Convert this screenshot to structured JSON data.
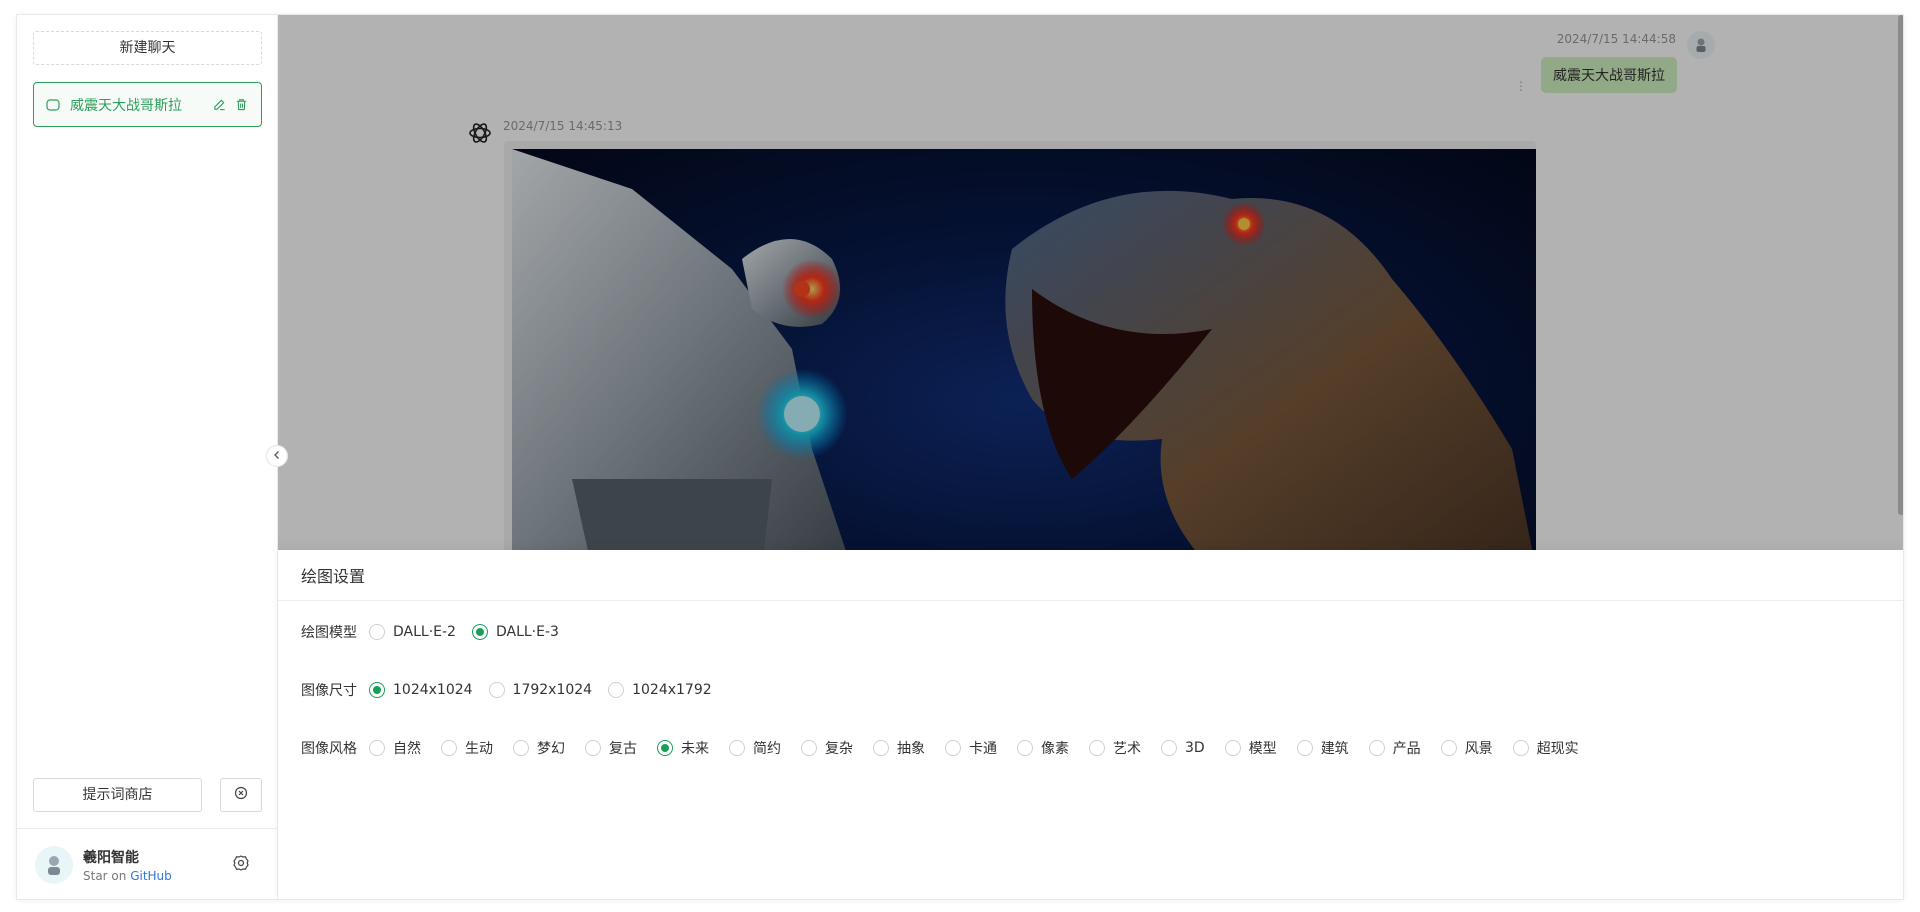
{
  "sidebar": {
    "new_chat_label": "新建聊天",
    "chats": [
      {
        "title": "威震天大战哥斯拉"
      }
    ],
    "prompt_store_label": "提示词商店",
    "user": {
      "name": "羲阳智能",
      "sub_prefix": "Star on ",
      "sub_link": "GitHub"
    }
  },
  "chat": {
    "user_message": {
      "time": "2024/7/15 14:44:58",
      "text": "威震天大战哥斯拉"
    },
    "ai_message": {
      "time": "2024/7/15 14:45:13"
    }
  },
  "drawer": {
    "title": "绘图设置",
    "model": {
      "label": "绘图模型",
      "options": [
        "DALL·E-2",
        "DALL·E-3"
      ],
      "selected": "DALL·E-3"
    },
    "size": {
      "label": "图像尺寸",
      "options": [
        "1024x1024",
        "1792x1024",
        "1024x1792"
      ],
      "selected": "1024x1024"
    },
    "style": {
      "label": "图像风格",
      "options": [
        "自然",
        "生动",
        "梦幻",
        "复古",
        "未来",
        "简约",
        "复杂",
        "抽象",
        "卡通",
        "像素",
        "艺术",
        "3D",
        "模型",
        "建筑",
        "产品",
        "风景",
        "超现实"
      ],
      "selected": "未来"
    }
  },
  "colors": {
    "accent": "#18a058",
    "bubble": "#d2f2c2",
    "link": "#2f77d8"
  }
}
